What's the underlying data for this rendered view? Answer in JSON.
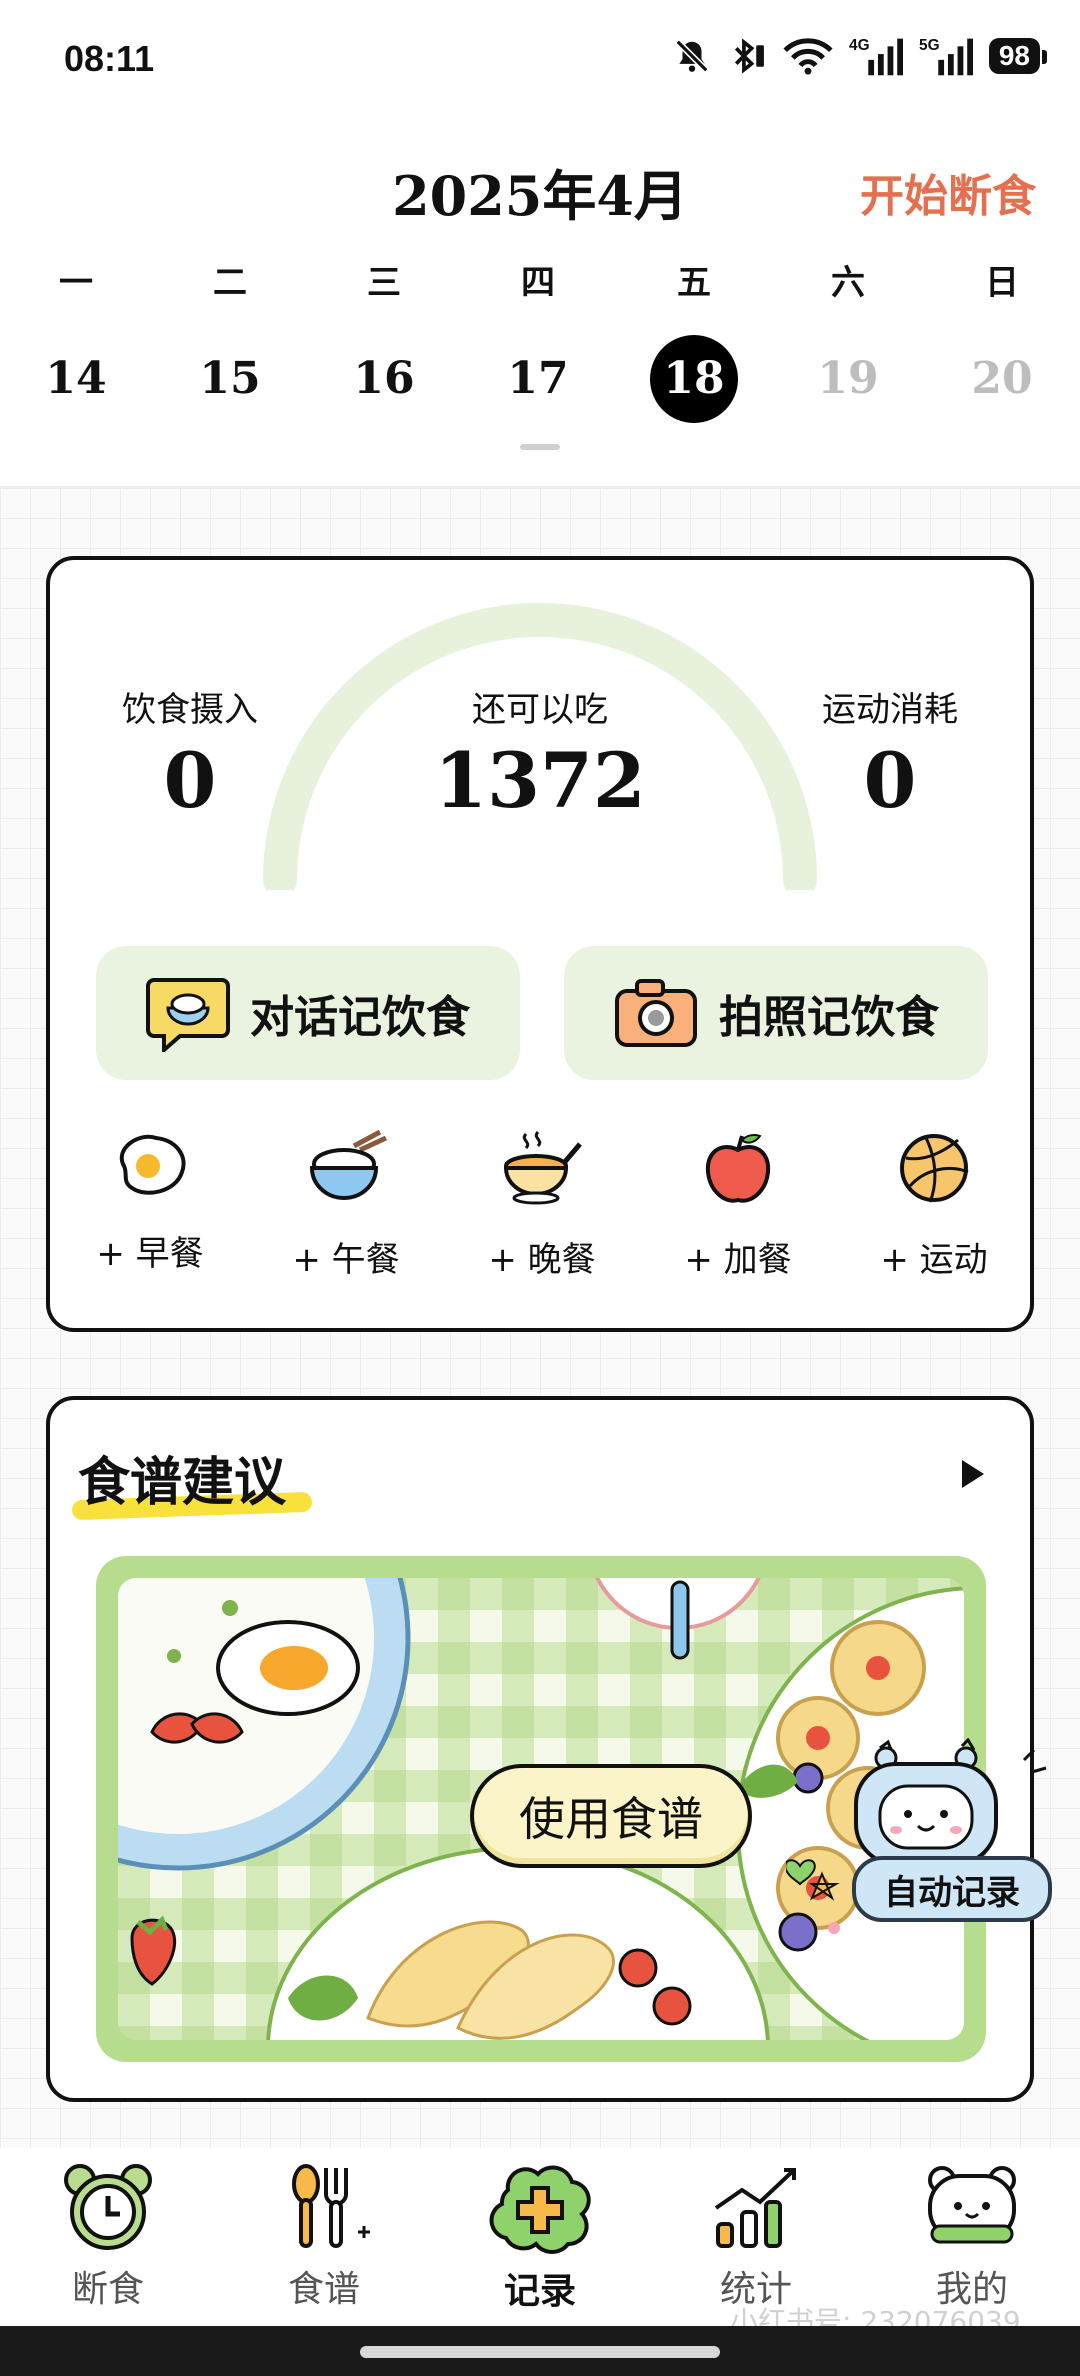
{
  "status_bar": {
    "time": "08:11",
    "icons": [
      "mute-bell-icon",
      "bluetooth-icon",
      "wifi-icon",
      "4g-signal-icon",
      "5g-signal-icon"
    ],
    "battery": "98"
  },
  "header": {
    "month": "2025年4月",
    "start_fasting": "开始断食"
  },
  "week": {
    "weekdays": [
      "一",
      "二",
      "三",
      "四",
      "五",
      "六",
      "日"
    ],
    "dates": [
      "14",
      "15",
      "16",
      "17",
      "18",
      "19",
      "20"
    ],
    "selected_index": 4
  },
  "summary": {
    "intake_label": "饮食摄入",
    "intake_value": "0",
    "remaining_label": "还可以吃",
    "remaining_value": "1372",
    "burn_label": "运动消耗",
    "burn_value": "0",
    "chat_record": "对话记饮食",
    "photo_record": "拍照记饮食",
    "meals": [
      "+ 早餐",
      "+ 午餐",
      "+ 晚餐",
      "+ 加餐",
      "+ 运动"
    ]
  },
  "recipe": {
    "title": "食谱建议",
    "use_button": "使用食谱",
    "auto_record": "自动记录"
  },
  "nav": {
    "items": [
      "断食",
      "食谱",
      "记录",
      "统计",
      "我的"
    ],
    "active_index": 2
  },
  "watermark": "小红书号: 232076039",
  "colors": {
    "accent_orange": "#e4704f",
    "soft_green": "#e9f3e0",
    "gauge_green": "#e8f1dc"
  }
}
